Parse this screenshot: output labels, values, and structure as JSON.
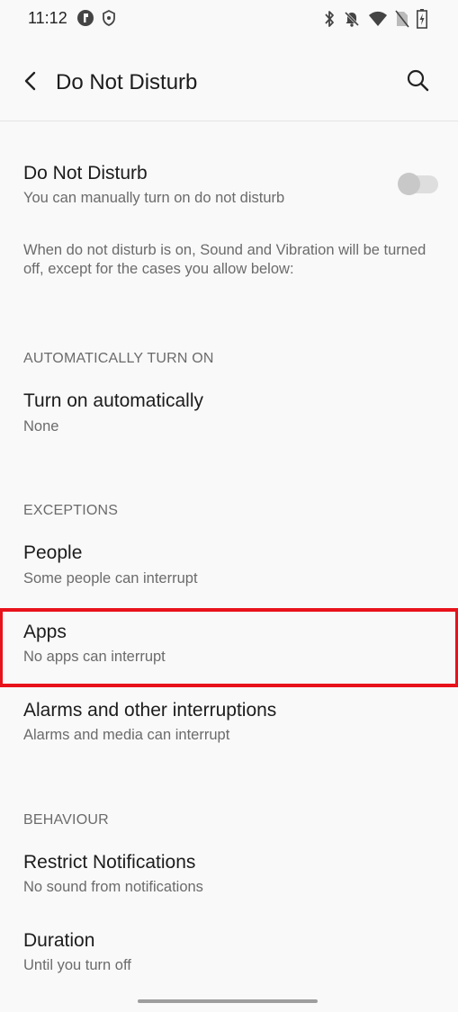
{
  "status_bar": {
    "time": "11:12"
  },
  "header": {
    "title": "Do Not Disturb",
    "back_icon": "chevron-left-icon",
    "search_icon": "search-icon"
  },
  "dnd": {
    "title": "Do Not Disturb",
    "subtitle": "You can manually turn on do not disturb",
    "toggle_on": false,
    "description": "When do not disturb is on, Sound and Vibration will be turned off, except for the cases you allow below:"
  },
  "sections": {
    "auto": {
      "header": "AUTOMATICALLY TURN ON",
      "items": [
        {
          "title": "Turn on automatically",
          "subtitle": "None"
        }
      ]
    },
    "exceptions": {
      "header": "EXCEPTIONS",
      "items": [
        {
          "title": "People",
          "subtitle": "Some people can interrupt"
        },
        {
          "title": "Apps",
          "subtitle": "No apps can interrupt"
        },
        {
          "title": "Alarms and other interruptions",
          "subtitle": "Alarms and media can interrupt"
        }
      ]
    },
    "behaviour": {
      "header": "BEHAVIOUR",
      "items": [
        {
          "title": "Restrict Notifications",
          "subtitle": "No sound from notifications"
        },
        {
          "title": "Duration",
          "subtitle": "Until you turn off"
        }
      ]
    }
  },
  "colors": {
    "highlight": "#e8121b",
    "background": "#f9f9f9"
  }
}
